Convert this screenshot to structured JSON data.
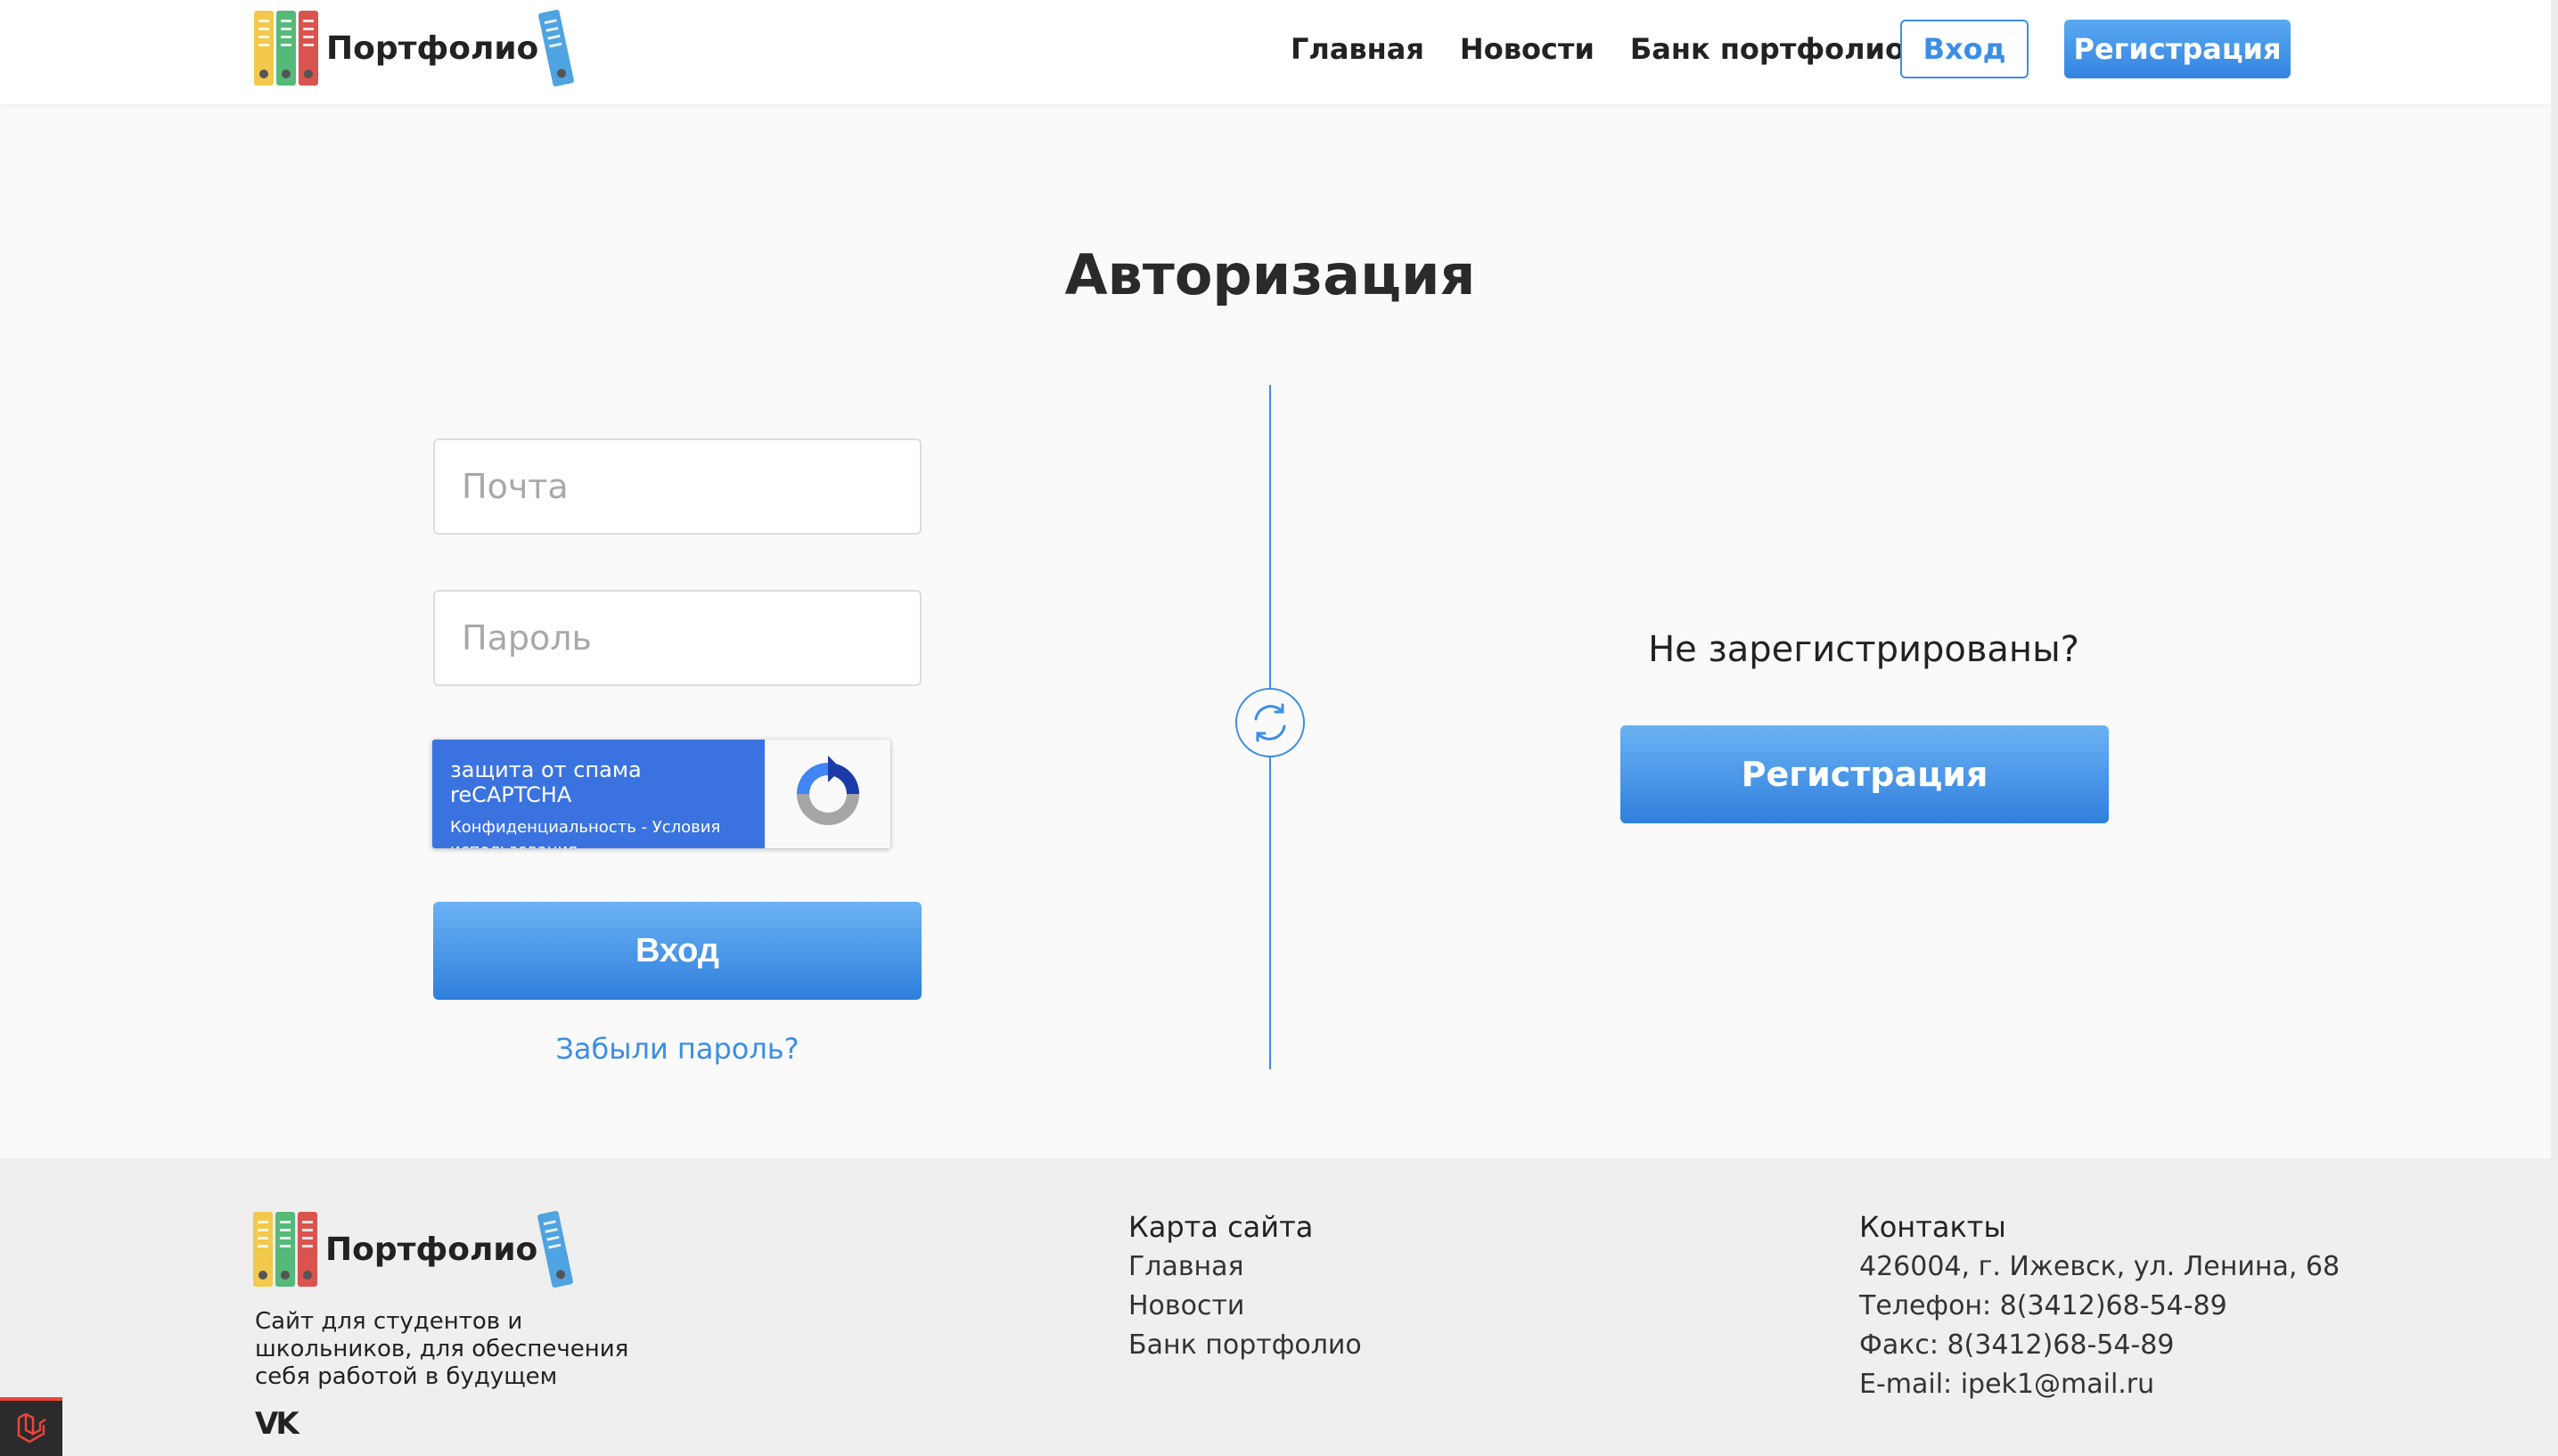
{
  "header": {
    "logo_text": "Портфолио",
    "nav": [
      "Главная",
      "Новости",
      "Банк портфолио"
    ],
    "login_label": "Вход",
    "register_label": "Регистрация"
  },
  "auth": {
    "title": "Авторизация",
    "email_placeholder": "Почта",
    "password_placeholder": "Пароль",
    "captcha_title": "защита от спама reCAPTCHA",
    "captcha_links": "Конфиденциальность - Условия использования",
    "login_button": "Вход",
    "forgot_link": "Забыли пароль?",
    "not_registered": "Не зарегистрированы?",
    "register_button": "Регистрация"
  },
  "footer": {
    "logo_text": "Портфолио",
    "description": "Сайт для студентов и школьников, для обеспечения себя работой в будущем",
    "social": "VK",
    "sitemap_title": "Карта сайта",
    "sitemap": [
      "Главная",
      "Новости",
      "Банк портфолио"
    ],
    "contacts_title": "Контакты",
    "contacts": [
      "426004, г. Ижевск, ул. Ленина, 68",
      "Телефон: 8(3412)68-54-89",
      "Факс: 8(3412)68-54-89",
      "E-mail: ipek1@mail.ru"
    ]
  },
  "colors": {
    "accent": "#3b8ee6",
    "button_gradient_top": "#6bb2f4",
    "button_gradient_bottom": "#2f7fdc",
    "captcha_blue": "#3a73e0"
  }
}
